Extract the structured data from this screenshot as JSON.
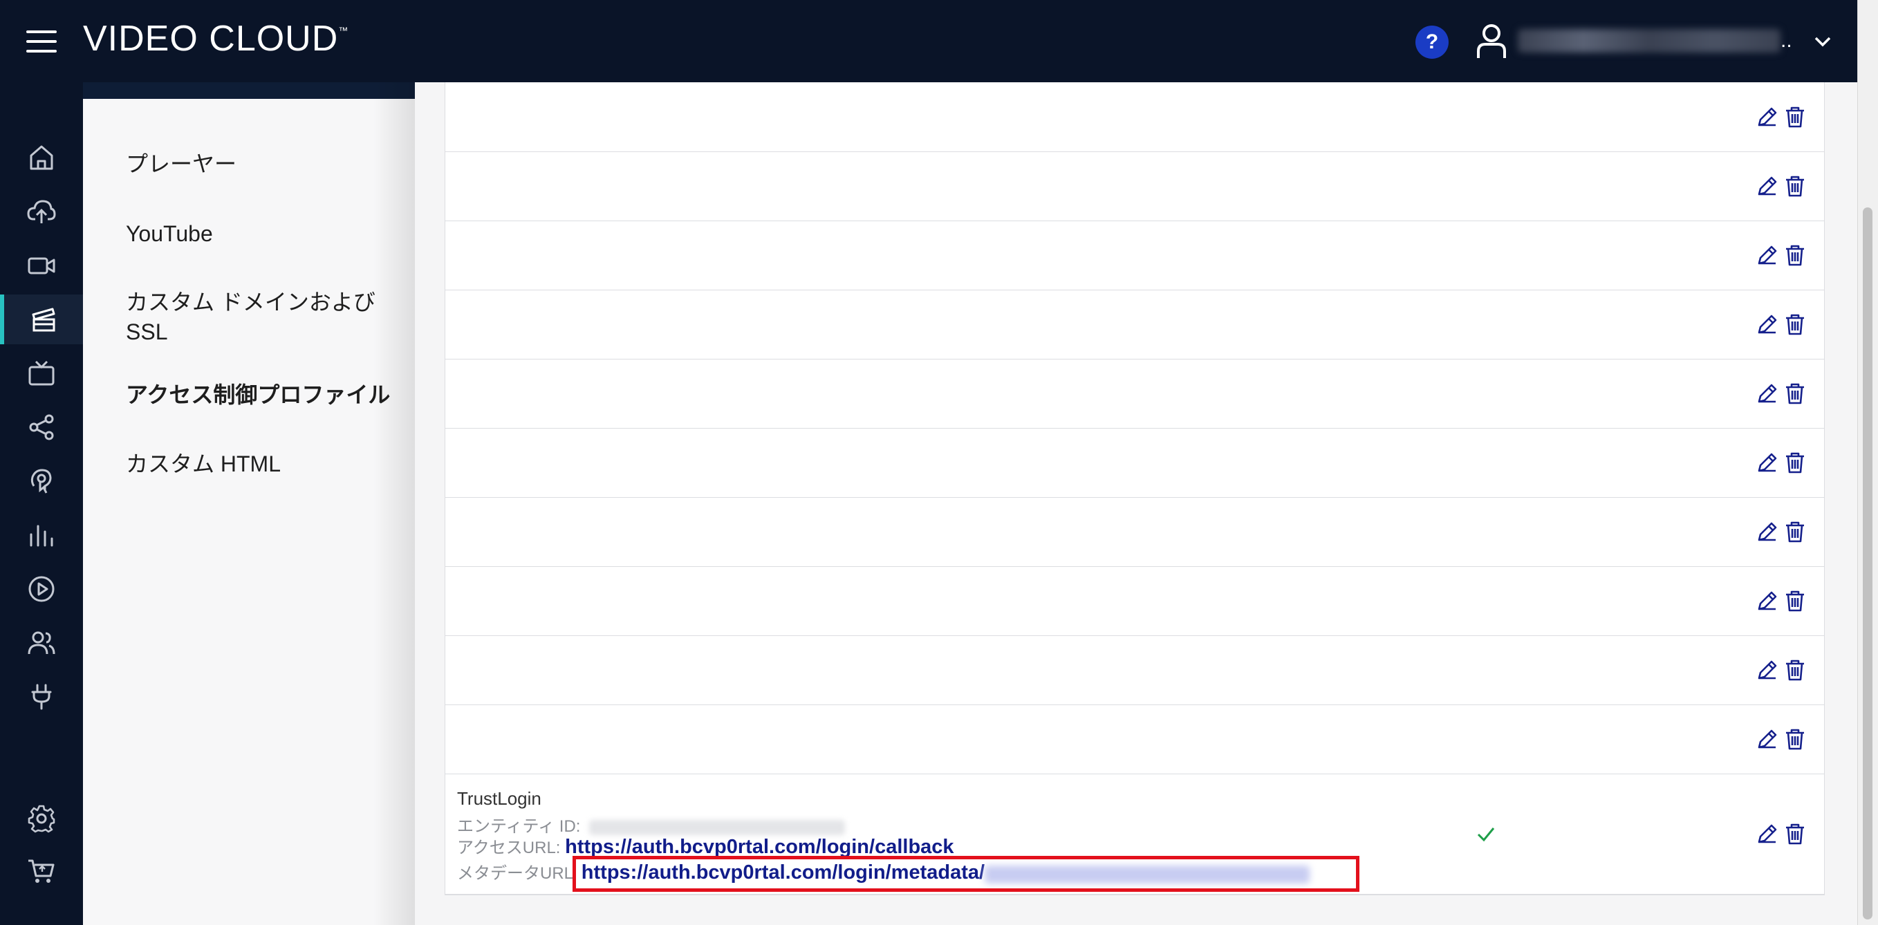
{
  "header": {
    "brand": "VIDEO CLOUD",
    "brand_tm": "™",
    "help": "?",
    "user_ellipsis": ".."
  },
  "rail": {
    "icons": [
      "home-icon",
      "upload-icon",
      "video-camera-icon",
      "media-module-icon",
      "tv-icon",
      "share-icon",
      "audience-icon",
      "analytics-icon",
      "players-icon",
      "users-icon",
      "plug-icon",
      "settings-icon",
      "cart-icon"
    ],
    "active": "media-module-icon",
    "accent": "#28c2c1"
  },
  "subnav": {
    "items": [
      {
        "label": "プレーヤー"
      },
      {
        "label": "YouTube"
      },
      {
        "label": "カスタム ドメインおよび SSL"
      },
      {
        "label": "アクセス制御プロファイル",
        "active": true
      },
      {
        "label": "カスタム HTML"
      }
    ]
  },
  "profile": {
    "name": "TrustLogin",
    "entity_label": "エンティティ ID:",
    "access_label": "アクセスURL:",
    "access_url": "https://auth.bcvp0rtal.com/login/callback",
    "metadata_label": "メタデータURL",
    "metadata_url": "https://auth.bcvp0rtal.com/login/metadata/"
  },
  "colors": {
    "topbar": "#0a1428",
    "link": "#111d8a",
    "highlight": "#e3101c",
    "check": "#1e9e49"
  }
}
